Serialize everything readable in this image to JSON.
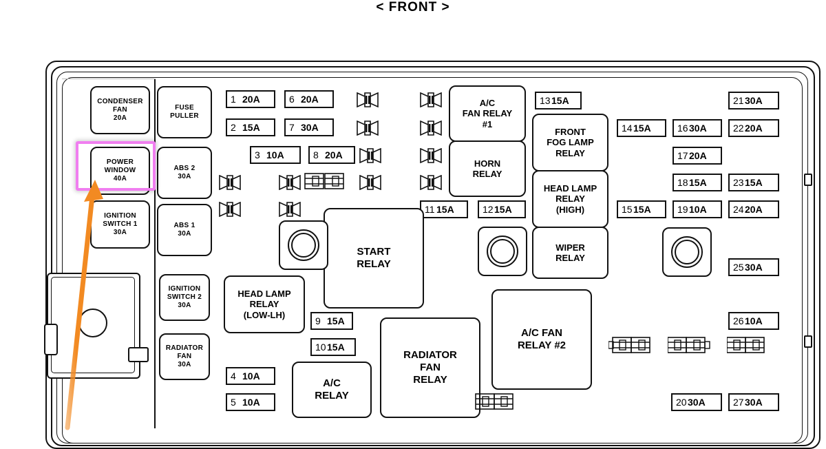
{
  "diagram": {
    "title": "< FRONT >",
    "accent_highlight_color": "#f07ef0",
    "arrow_color": "#f28a22"
  },
  "left_column": {
    "blocks": [
      {
        "name": "condenser-fan",
        "lines": [
          "CONDENSER",
          "FAN",
          "20A"
        ]
      },
      {
        "name": "power-window",
        "lines": [
          "POWER",
          "WINDOW",
          "40A"
        ],
        "highlighted": "true"
      },
      {
        "name": "ignition-switch-1",
        "lines": [
          "IGNITION",
          "SWITCH 1",
          "30A"
        ]
      },
      {
        "name": "ignition-switch-2",
        "lines": [
          "IGNITION",
          "SWITCH 2",
          "30A"
        ]
      },
      {
        "name": "radiator-fan",
        "lines": [
          "RADIATOR",
          "FAN",
          "30A"
        ]
      }
    ]
  },
  "second_column": {
    "blocks": [
      {
        "name": "fuse-puller",
        "lines": [
          "FUSE",
          "PULLER"
        ]
      },
      {
        "name": "abs-2",
        "lines": [
          "ABS 2",
          "30A"
        ]
      },
      {
        "name": "abs-1",
        "lines": [
          "ABS 1",
          "30A"
        ]
      }
    ]
  },
  "relays": [
    {
      "name": "ac-fan-relay-1",
      "lines": [
        "A/C",
        "FAN RELAY",
        "#1"
      ]
    },
    {
      "name": "horn-relay",
      "lines": [
        "HORN",
        "RELAY"
      ]
    },
    {
      "name": "front-fog-lamp-relay",
      "lines": [
        "FRONT",
        "FOG LAMP",
        "RELAY"
      ]
    },
    {
      "name": "head-lamp-relay-high",
      "lines": [
        "HEAD LAMP",
        "RELAY",
        "(HIGH)"
      ]
    },
    {
      "name": "wiper-relay",
      "lines": [
        "WIPER",
        "RELAY"
      ]
    },
    {
      "name": "start-relay",
      "lines": [
        "START",
        "RELAY"
      ]
    },
    {
      "name": "head-lamp-relay-low-lh",
      "lines": [
        "HEAD LAMP",
        "RELAY",
        "(LOW-LH)"
      ]
    },
    {
      "name": "ac-relay",
      "lines": [
        "A/C",
        "RELAY"
      ]
    },
    {
      "name": "radiator-fan-relay",
      "lines": [
        "RADIATOR",
        "FAN",
        "RELAY"
      ]
    },
    {
      "name": "ac-fan-relay-2",
      "lines": [
        "A/C FAN",
        "RELAY #2"
      ]
    }
  ],
  "fuses": [
    {
      "num": "1",
      "amp": "20A"
    },
    {
      "num": "2",
      "amp": "15A"
    },
    {
      "num": "3",
      "amp": "10A"
    },
    {
      "num": "4",
      "amp": "10A"
    },
    {
      "num": "5",
      "amp": "10A"
    },
    {
      "num": "6",
      "amp": "20A"
    },
    {
      "num": "7",
      "amp": "30A"
    },
    {
      "num": "8",
      "amp": "20A"
    },
    {
      "num": "9",
      "amp": "15A"
    },
    {
      "num": "10",
      "amp": "15A"
    },
    {
      "num": "11",
      "amp": "15A"
    },
    {
      "num": "12",
      "amp": "15A"
    },
    {
      "num": "13",
      "amp": "15A"
    },
    {
      "num": "14",
      "amp": "15A"
    },
    {
      "num": "15",
      "amp": "15A"
    },
    {
      "num": "16",
      "amp": "30A"
    },
    {
      "num": "17",
      "amp": "20A"
    },
    {
      "num": "18",
      "amp": "15A"
    },
    {
      "num": "19",
      "amp": "10A"
    },
    {
      "num": "20",
      "amp": "30A"
    },
    {
      "num": "21",
      "amp": "30A"
    },
    {
      "num": "22",
      "amp": "20A"
    },
    {
      "num": "23",
      "amp": "15A"
    },
    {
      "num": "24",
      "amp": "20A"
    },
    {
      "num": "25",
      "amp": "30A"
    },
    {
      "num": "26",
      "amp": "10A"
    },
    {
      "num": "27",
      "amp": "30A"
    }
  ]
}
